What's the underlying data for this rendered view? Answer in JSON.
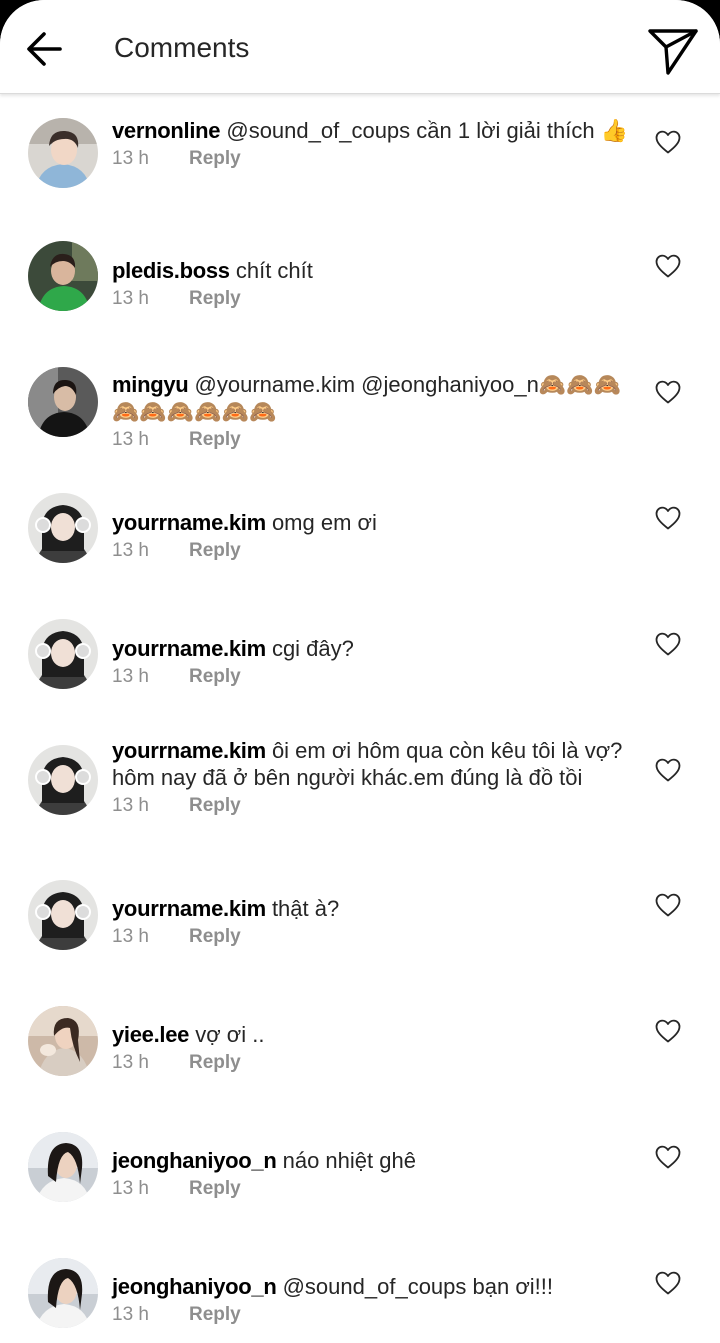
{
  "header": {
    "title": "Comments",
    "back_icon": "arrow-left-icon",
    "send_icon": "paper-plane-icon"
  },
  "colors": {
    "text_primary": "#262626",
    "text_secondary": "#8e8e8e",
    "divider": "#dbdbdb",
    "background": "#ffffff"
  },
  "comments": [
    {
      "username": "vernonline",
      "text": " @sound_of_coups cần 1 lời giải thích 👍",
      "time": "13 h",
      "reply": "Reply",
      "like_icon": "heart-outline-icon"
    },
    {
      "username": "pledis.boss",
      "text": " chít chít",
      "time": "13 h",
      "reply": "Reply",
      "like_icon": "heart-outline-icon"
    },
    {
      "username": "mingyu",
      "text": " @yourname.kim @jeonghaniyoo_n🙈🙈🙈🙈🙈🙈🙈🙈🙈",
      "time": "13 h",
      "reply": "Reply",
      "like_icon": "heart-outline-icon"
    },
    {
      "username": "yourrname.kim",
      "text": " omg em ơi",
      "time": "13 h",
      "reply": "Reply",
      "like_icon": "heart-outline-icon"
    },
    {
      "username": "yourrname.kim",
      "text": " cgi đây?",
      "time": "13 h",
      "reply": "Reply",
      "like_icon": "heart-outline-icon"
    },
    {
      "username": "yourrname.kim",
      "text": " ôi em ơi hôm qua còn kêu tôi là vợ?hôm nay đã ở bên người khác.em đúng là đồ tồi",
      "time": "13 h",
      "reply": "Reply",
      "like_icon": "heart-outline-icon"
    },
    {
      "username": "yourrname.kim",
      "text": " thật à?",
      "time": "13 h",
      "reply": "Reply",
      "like_icon": "heart-outline-icon"
    },
    {
      "username": "yiee.lee",
      "text": " vợ ơi ..",
      "time": "13 h",
      "reply": "Reply",
      "like_icon": "heart-outline-icon"
    },
    {
      "username": "jeonghaniyoo_n",
      "text": " náo nhiệt ghê",
      "time": "13 h",
      "reply": "Reply",
      "like_icon": "heart-outline-icon"
    },
    {
      "username": "jeonghaniyoo_n",
      "text": " @sound_of_coups bạn ơi!!!",
      "time": "13 h",
      "reply": "Reply",
      "like_icon": "heart-outline-icon"
    }
  ]
}
